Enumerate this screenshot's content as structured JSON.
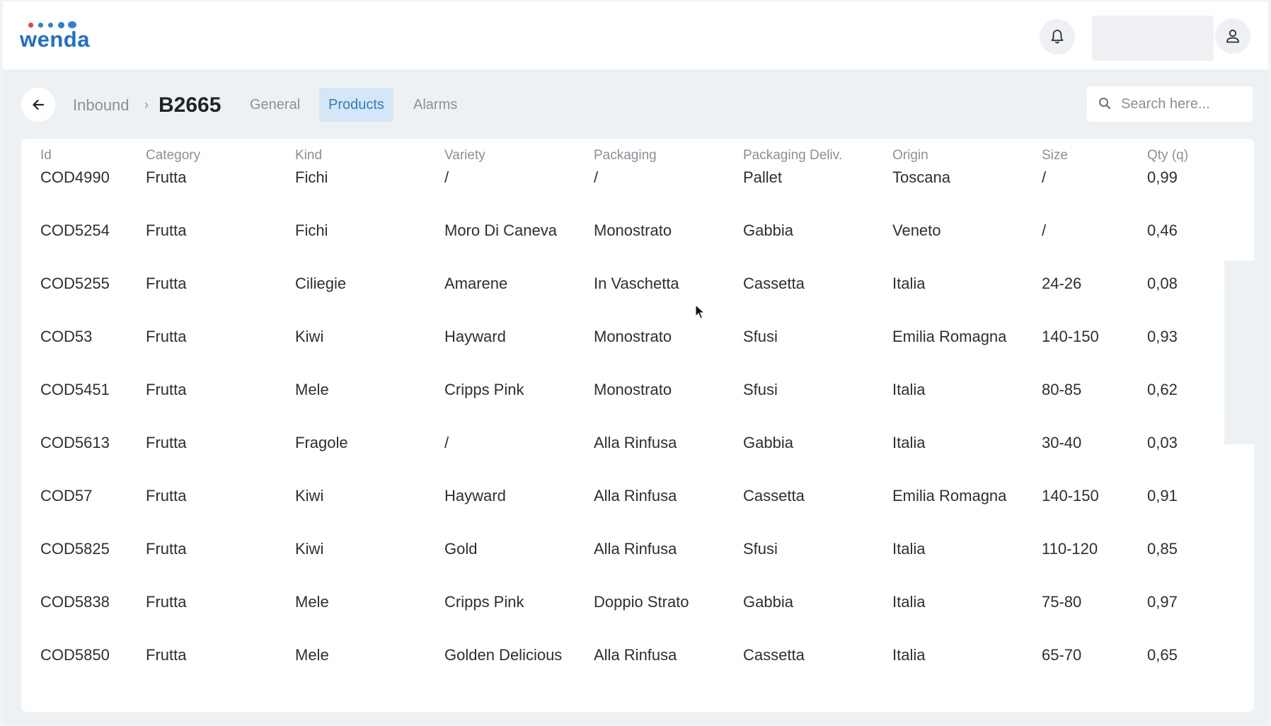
{
  "app": {
    "logo_text": "wenda"
  },
  "header": {
    "notifications_icon": "bell-icon",
    "user_icon": "user-icon"
  },
  "breadcrumb": {
    "parent": "Inbound",
    "separator": "›",
    "current": "B2665"
  },
  "tabs": [
    {
      "label": "General",
      "active": false
    },
    {
      "label": "Products",
      "active": true
    },
    {
      "label": "Alarms",
      "active": false
    }
  ],
  "search": {
    "placeholder": "Search here..."
  },
  "colors": {
    "brand_blue": "#1e6fc8",
    "logo_red": "#e04545",
    "active_tab_bg": "#d5e6f6",
    "active_tab_text": "#2d7fc6"
  },
  "table": {
    "columns": [
      "Id",
      "Category",
      "Kind",
      "Variety",
      "Packaging",
      "Packaging Deliv.",
      "Origin",
      "Size",
      "Qty (q)"
    ],
    "rows": [
      [
        "COD4990",
        "Frutta",
        "Fichi",
        "/",
        "/",
        "Pallet",
        "Toscana",
        "/",
        "0,99"
      ],
      [
        "COD5254",
        "Frutta",
        "Fichi",
        "Moro Di Caneva",
        "Monostrato",
        "Gabbia",
        "Veneto",
        "/",
        "0,46"
      ],
      [
        "COD5255",
        "Frutta",
        "Ciliegie",
        "Amarene",
        "In Vaschetta",
        "Cassetta",
        "Italia",
        "24-26",
        "0,08"
      ],
      [
        "COD53",
        "Frutta",
        "Kiwi",
        "Hayward",
        "Monostrato",
        "Sfusi",
        "Emilia Romagna",
        "140-150",
        "0,93"
      ],
      [
        "COD5451",
        "Frutta",
        "Mele",
        "Cripps Pink",
        "Monostrato",
        "Sfusi",
        "Italia",
        "80-85",
        "0,62"
      ],
      [
        "COD5613",
        "Frutta",
        "Fragole",
        "/",
        "Alla Rinfusa",
        "Gabbia",
        "Italia",
        "30-40",
        "0,03"
      ],
      [
        "COD57",
        "Frutta",
        "Kiwi",
        "Hayward",
        "Alla Rinfusa",
        "Cassetta",
        "Emilia Romagna",
        "140-150",
        "0,91"
      ],
      [
        "COD5825",
        "Frutta",
        "Kiwi",
        "Gold",
        "Alla Rinfusa",
        "Sfusi",
        "Italia",
        "110-120",
        "0,85"
      ],
      [
        "COD5838",
        "Frutta",
        "Mele",
        "Cripps Pink",
        "Doppio Strato",
        "Gabbia",
        "Italia",
        "75-80",
        "0,97"
      ],
      [
        "COD5850",
        "Frutta",
        "Mele",
        "Golden Delicious",
        "Alla Rinfusa",
        "Cassetta",
        "Italia",
        "65-70",
        "0,65"
      ]
    ]
  }
}
